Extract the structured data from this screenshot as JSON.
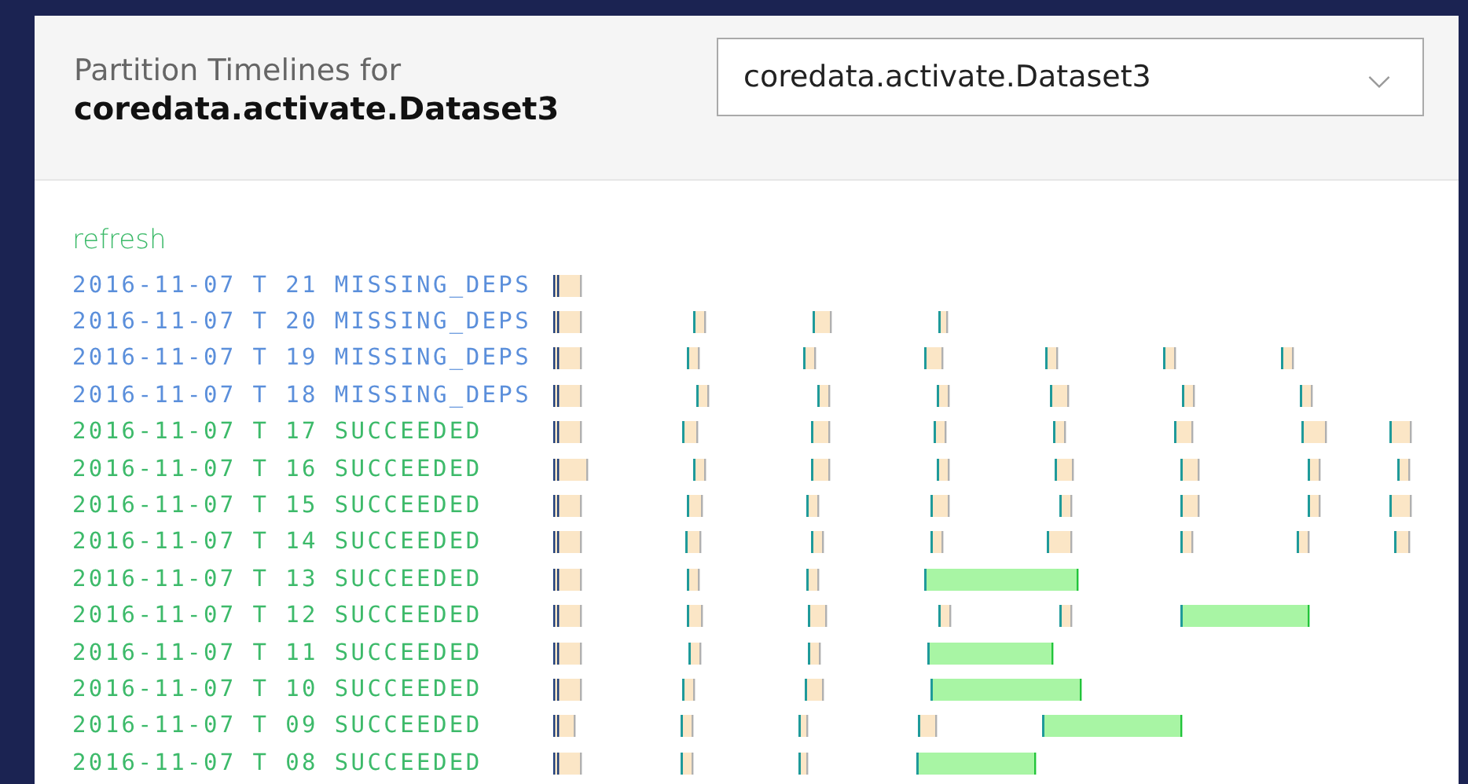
{
  "header": {
    "title": "Partition Timelines for",
    "dataset": "coredata.activate.Dataset3"
  },
  "dataset_select": {
    "value": "coredata.activate.Dataset3"
  },
  "refresh_link": "refresh",
  "partitions": [
    {
      "label": "2016-11-07 T 21 MISSING_DEPS",
      "kind": "missing"
    },
    {
      "label": "2016-11-07 T 20 MISSING_DEPS",
      "kind": "missing"
    },
    {
      "label": "2016-11-07 T 19 MISSING_DEPS",
      "kind": "missing"
    },
    {
      "label": "2016-11-07 T 18 MISSING_DEPS",
      "kind": "missing"
    },
    {
      "label": "2016-11-07 T 17 SUCCEEDED",
      "kind": "succeeded"
    },
    {
      "label": "2016-11-07 T 16 SUCCEEDED",
      "kind": "succeeded"
    },
    {
      "label": "2016-11-07 T 15 SUCCEEDED",
      "kind": "succeeded"
    },
    {
      "label": "2016-11-07 T 14 SUCCEEDED",
      "kind": "succeeded"
    },
    {
      "label": "2016-11-07 T 13 SUCCEEDED",
      "kind": "succeeded"
    },
    {
      "label": "2016-11-07 T 12 SUCCEEDED",
      "kind": "succeeded"
    },
    {
      "label": "2016-11-07 T 11 SUCCEEDED",
      "kind": "succeeded"
    },
    {
      "label": "2016-11-07 T 10 SUCCEEDED",
      "kind": "succeeded"
    },
    {
      "label": "2016-11-07 T 09 SUCCEEDED",
      "kind": "succeeded"
    },
    {
      "label": "2016-11-07 T 08 SUCCEEDED",
      "kind": "succeeded"
    }
  ]
}
